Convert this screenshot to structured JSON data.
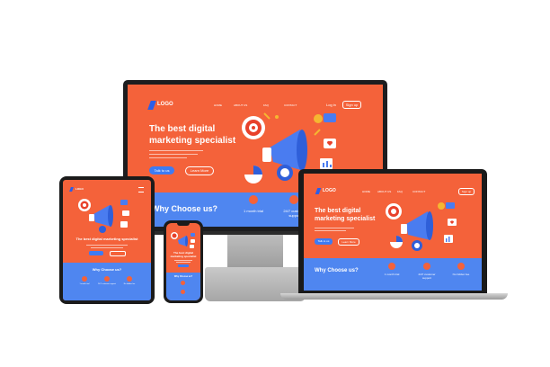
{
  "colors": {
    "accent_orange": "#f4623a",
    "band_blue": "#4f86f0",
    "button_blue": "#3e7bf3",
    "bezel": "#1d1d1f"
  },
  "monitor": {
    "logo": "LOGO",
    "nav": [
      "HOME",
      "ABOUT US",
      "FAQ",
      "CONTACT"
    ],
    "login": "Log in",
    "signup": "Sign up",
    "headline_line1": "The best digital",
    "headline_line2": "marketing specialist",
    "primary_button": "Talk to us",
    "secondary_button": "Learn More",
    "why_title": "Why Choose us?",
    "features": [
      "1 month trial",
      "24/7 customer support"
    ]
  },
  "laptop": {
    "logo": "LOGO",
    "nav": [
      "HOME",
      "ABOUT US",
      "FAQ",
      "CONTACT"
    ],
    "signup": "Sign up",
    "headline_line1": "The best digital",
    "headline_line2": "marketing specialist",
    "primary_button": "Talk to us",
    "secondary_button": "Learn More",
    "why_title": "Why Choose us?",
    "features": [
      "1 month trial",
      "24/7 customer support",
      "No hidden fee"
    ]
  },
  "tablet": {
    "logo": "LOGO",
    "headline": "The best digital marketing specialist",
    "why_title": "Why Choose us?",
    "features": [
      "1 month trial",
      "24/7 customer support",
      "No hidden fee"
    ]
  },
  "phone": {
    "headline_line1": "The best digital",
    "headline_line2": "marketing specialist",
    "why_title": "Why Choose us?"
  }
}
